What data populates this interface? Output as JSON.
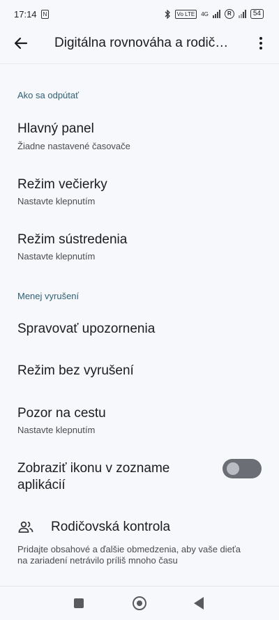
{
  "status_bar": {
    "time": "17:14",
    "nfc_label": "N",
    "volte_label": "Vo LTE",
    "network_label": "4G",
    "roaming_label": "R",
    "battery": "54"
  },
  "app_bar": {
    "title": "Digitálna rovnováha a rodič…"
  },
  "sections": {
    "disconnect": {
      "header": "Ako sa odpútať",
      "items": [
        {
          "title": "Hlavný panel",
          "subtitle": "Žiadne nastavené časovače"
        },
        {
          "title": "Režim večierky",
          "subtitle": "Nastavte klepnutím"
        },
        {
          "title": "Režim sústredenia",
          "subtitle": "Nastavte klepnutím"
        }
      ]
    },
    "interruptions": {
      "header": "Menej vyrušení",
      "items": [
        {
          "title": "Spravovať upozornenia"
        },
        {
          "title": "Režim bez vyrušení"
        },
        {
          "title": "Pozor na cestu",
          "subtitle": "Nastavte klepnutím"
        }
      ],
      "toggle_row": {
        "title_line1": "Zobraziť ikonu v zozname",
        "title_line2": "aplikácií",
        "state": "off"
      }
    },
    "parental": {
      "title": "Rodičovská kontrola",
      "description_line1": "Pridajte obsahové a ďalšie obmedzenia, aby vaše dieťa",
      "description_line2": "na zariadení netrávilo príliš mnoho času"
    }
  },
  "icons": {
    "back": "arrow-back-icon",
    "more": "more-vert-icon",
    "parental": "people-icon"
  },
  "colors": {
    "background": "#f7f8fb",
    "section_header": "#2f5f73",
    "toggle_track": "#6b6f75"
  }
}
